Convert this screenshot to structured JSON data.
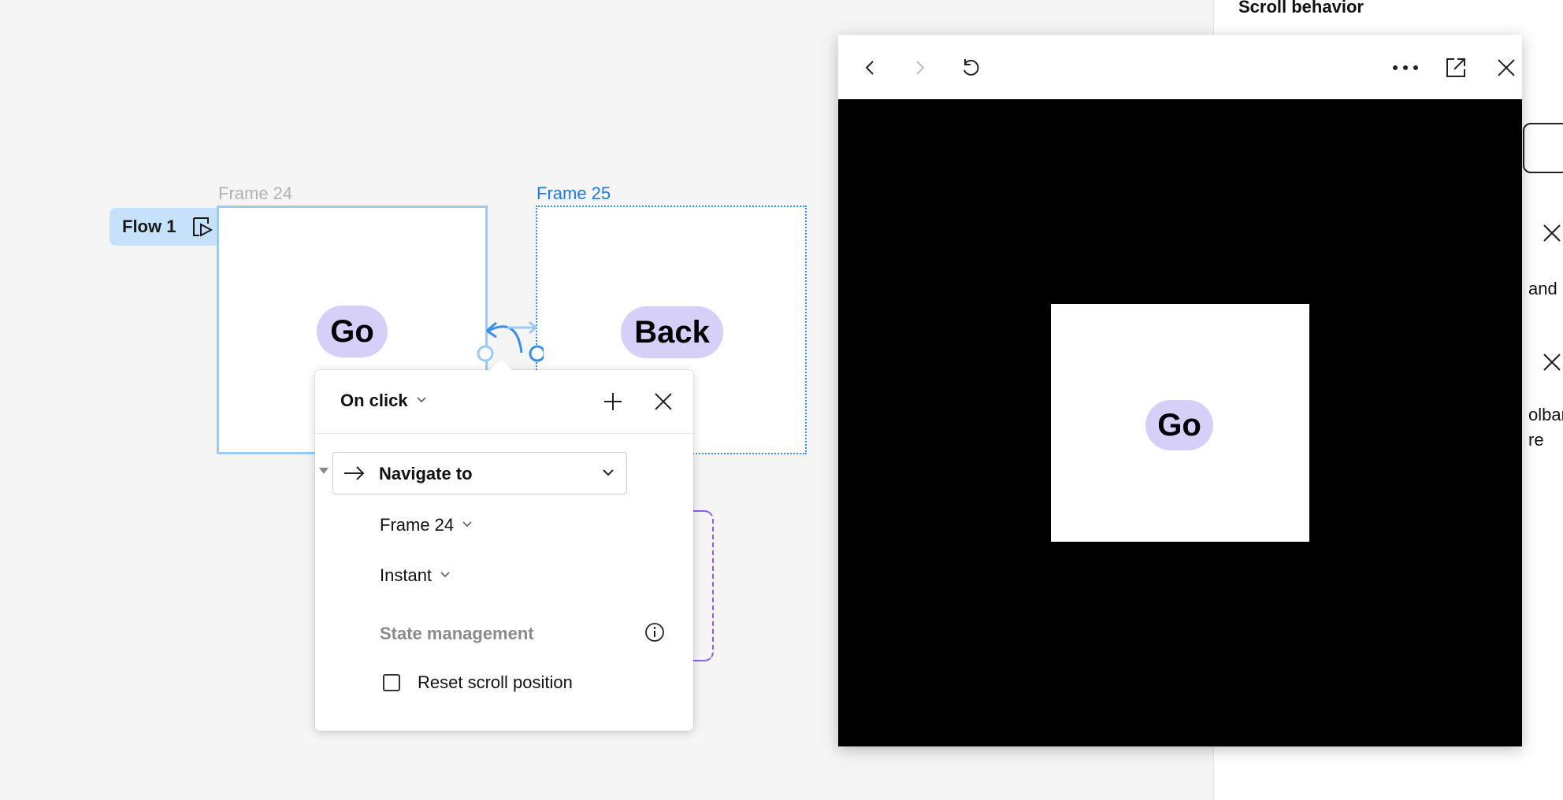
{
  "right_panel": {
    "title": "Scroll behavior",
    "fragments": [
      "and",
      "olbar",
      "re"
    ]
  },
  "canvas": {
    "flow": {
      "label": "Flow 1"
    },
    "frames": [
      {
        "name": "Frame 24",
        "button": "Go",
        "label_color": "#b3b3b3"
      },
      {
        "name": "Frame 25",
        "button": "Back",
        "label_color": "#1f7ae0"
      }
    ]
  },
  "popover": {
    "trigger": "On click",
    "action": "Navigate to",
    "destination": "Frame 24",
    "animation": "Instant",
    "state_management": "State management",
    "reset_scroll": "Reset scroll position",
    "reset_scroll_checked": false
  },
  "preview": {
    "frame_button": "Go",
    "toolbar": [
      "back-icon",
      "forward-icon",
      "restart-icon",
      "more-icon",
      "open-external-icon",
      "close-icon"
    ]
  },
  "colors": {
    "accent_blue": "#1f7ae0",
    "selection_blue": "#9ccaf2",
    "pill": "#d6d0f9",
    "flow_tag": "#c6e2fb",
    "purple": "#8b5cf6"
  }
}
